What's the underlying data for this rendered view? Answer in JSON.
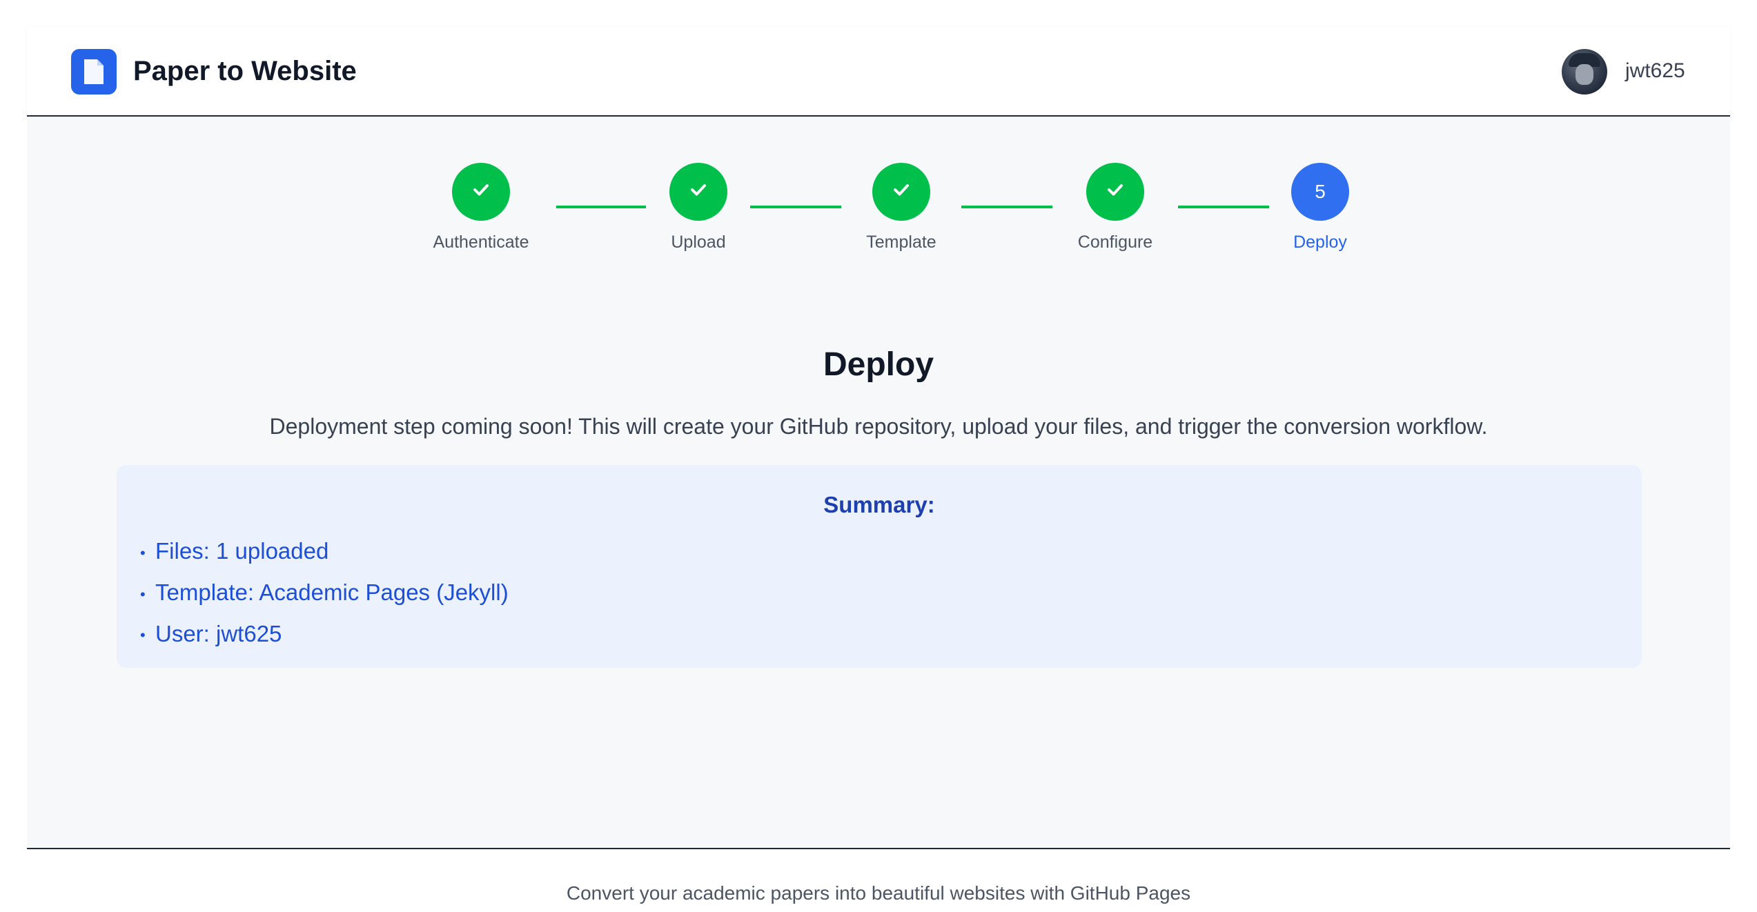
{
  "header": {
    "app_title": "Paper to Website",
    "logo_icon": "document-icon",
    "user": {
      "username": "jwt625",
      "avatar_icon": "avatar-photo"
    }
  },
  "stepper": {
    "steps": [
      {
        "label": "Authenticate",
        "status": "complete",
        "marker": "check-icon"
      },
      {
        "label": "Upload",
        "status": "complete",
        "marker": "check-icon"
      },
      {
        "label": "Template",
        "status": "complete",
        "marker": "check-icon"
      },
      {
        "label": "Configure",
        "status": "complete",
        "marker": "check-icon"
      },
      {
        "label": "Deploy",
        "status": "active",
        "number": "5"
      }
    ]
  },
  "main": {
    "heading": "Deploy",
    "description": "Deployment step coming soon! This will create your GitHub repository, upload your files, and trigger the conversion workflow.",
    "summary": {
      "title": "Summary:",
      "items": [
        "Files: 1 uploaded",
        "Template: Academic Pages (Jekyll)",
        "User: jwt625"
      ]
    }
  },
  "footer": {
    "text": "Convert your academic papers into beautiful websites with GitHub Pages"
  },
  "colors": {
    "brand_blue": "#2563eb",
    "step_complete": "#00c04b",
    "step_active": "#2f6ff0",
    "summary_bg": "#ebf2fd",
    "summary_text": "#1d4ed8"
  }
}
